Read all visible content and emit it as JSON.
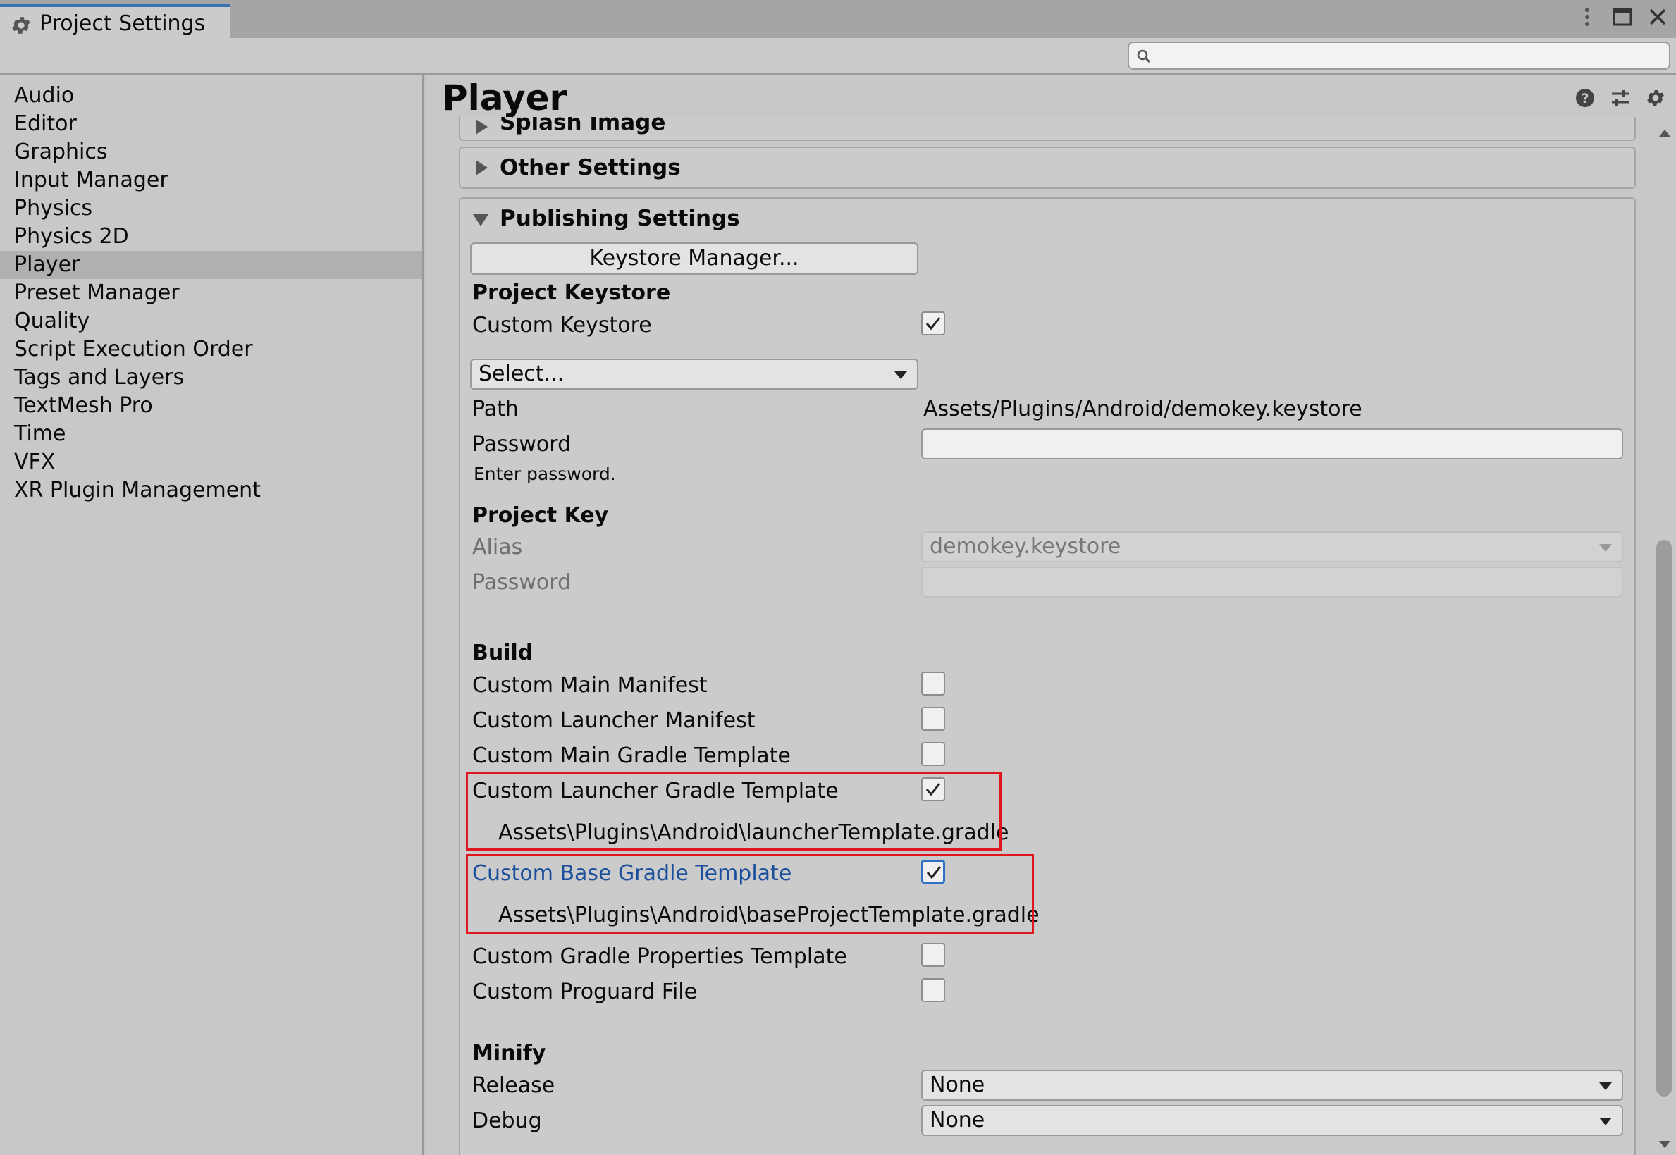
{
  "window": {
    "tab_title": "Project Settings"
  },
  "search": {
    "placeholder": ""
  },
  "sidebar": {
    "items": [
      {
        "label": "Audio"
      },
      {
        "label": "Editor"
      },
      {
        "label": "Graphics"
      },
      {
        "label": "Input Manager"
      },
      {
        "label": "Physics"
      },
      {
        "label": "Physics 2D"
      },
      {
        "label": "Player",
        "selected": true
      },
      {
        "label": "Preset Manager"
      },
      {
        "label": "Quality"
      },
      {
        "label": "Script Execution Order"
      },
      {
        "label": "Tags and Layers"
      },
      {
        "label": "TextMesh Pro"
      },
      {
        "label": "Time"
      },
      {
        "label": "VFX"
      },
      {
        "label": "XR Plugin Management"
      }
    ]
  },
  "main": {
    "title": "Player",
    "foldouts": {
      "splash": "Splash Image",
      "other": "Other Settings",
      "publishing": "Publishing Settings"
    },
    "keystore_manager_button": "Keystore Manager...",
    "project_keystore": {
      "heading": "Project Keystore",
      "custom_keystore_label": "Custom Keystore",
      "custom_keystore_checked": true,
      "select_value": "Select...",
      "path_label": "Path",
      "path_value": "Assets/Plugins/Android/demokey.keystore",
      "password_label": "Password",
      "password_value": "",
      "password_hint": "Enter password."
    },
    "project_key": {
      "heading": "Project Key",
      "alias_label": "Alias",
      "alias_value": "demokey.keystore",
      "password_label": "Password",
      "password_value": ""
    },
    "build": {
      "heading": "Build",
      "custom_main_manifest": {
        "label": "Custom Main Manifest",
        "checked": false
      },
      "custom_launcher_manifest": {
        "label": "Custom Launcher Manifest",
        "checked": false
      },
      "custom_main_gradle": {
        "label": "Custom Main Gradle Template",
        "checked": false
      },
      "custom_launcher_gradle": {
        "label": "Custom Launcher Gradle Template",
        "checked": true,
        "path": "Assets\\Plugins\\Android\\launcherTemplate.gradle"
      },
      "custom_base_gradle": {
        "label": "Custom Base Gradle Template",
        "checked": true,
        "path": "Assets\\Plugins\\Android\\baseProjectTemplate.gradle"
      },
      "custom_gradle_properties": {
        "label": "Custom Gradle Properties Template",
        "checked": false
      },
      "custom_proguard": {
        "label": "Custom Proguard File",
        "checked": false
      }
    },
    "minify": {
      "heading": "Minify",
      "release_label": "Release",
      "release_value": "None",
      "debug_label": "Debug",
      "debug_value": "None"
    }
  },
  "colors": {
    "highlight_box": "#e0161e",
    "link_label": "#1b4f9c",
    "tab_accent": "#3a72b0"
  }
}
